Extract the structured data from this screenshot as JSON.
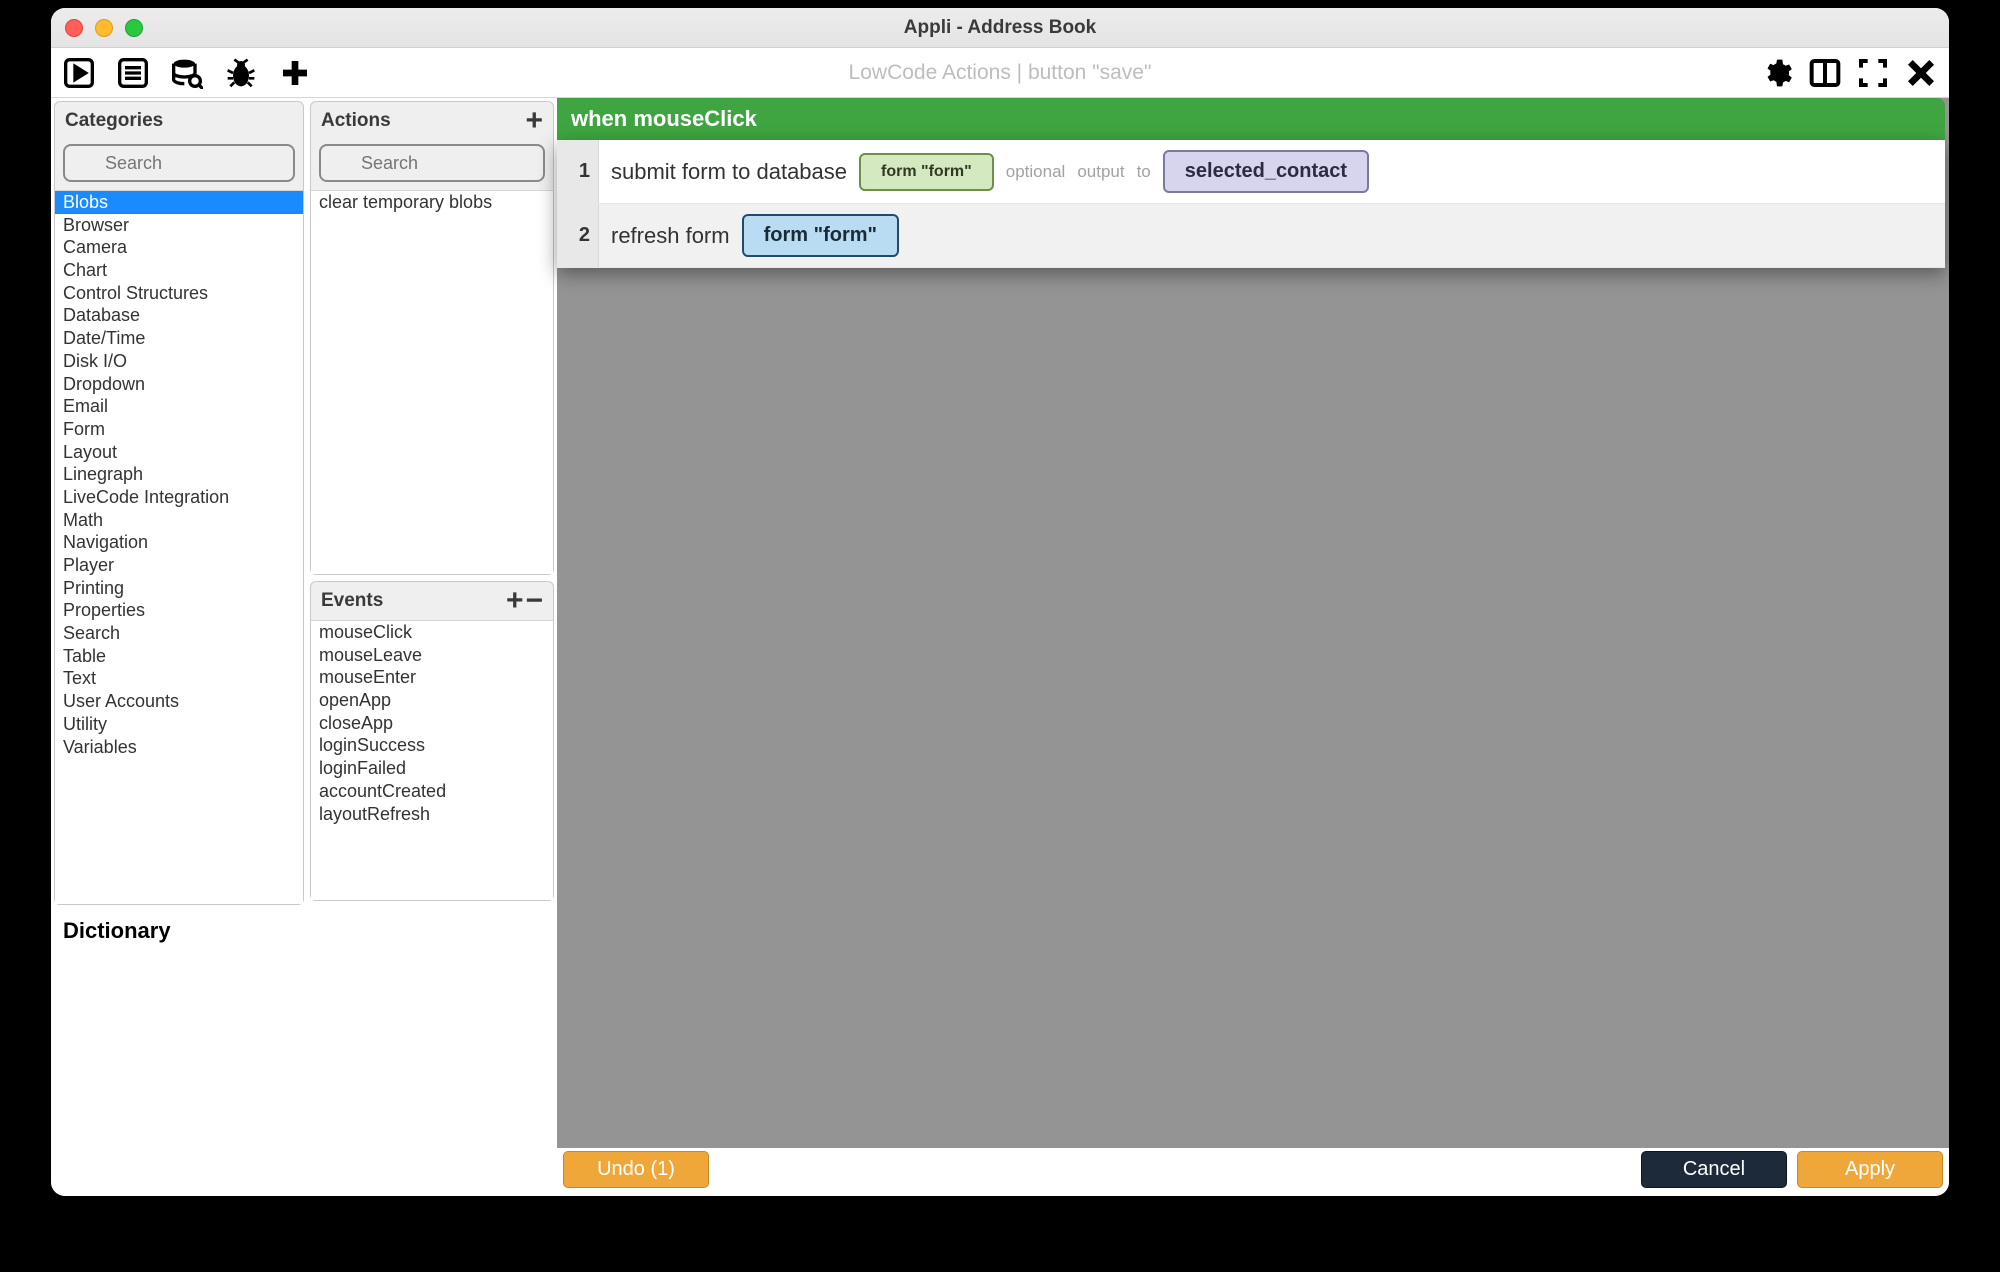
{
  "window": {
    "title": "Appli - Address Book"
  },
  "toolbar": {
    "subtitle": "LowCode Actions | button \"save\""
  },
  "categories": {
    "title": "Categories",
    "search_placeholder": "Search",
    "items": [
      "Blobs",
      "Browser",
      "Camera",
      "Chart",
      "Control Structures",
      "Database",
      "Date/Time",
      "Disk I/O",
      "Dropdown",
      "Email",
      "Form",
      "Layout",
      "Linegraph",
      "LiveCode Integration",
      "Math",
      "Navigation",
      "Player",
      "Printing",
      "Properties",
      "Search",
      "Table",
      "Text",
      "User Accounts",
      "Utility",
      "Variables"
    ],
    "selected": 0
  },
  "actions": {
    "title": "Actions",
    "search_placeholder": "Search",
    "items": [
      "clear temporary blobs"
    ]
  },
  "events": {
    "title": "Events",
    "items": [
      "mouseClick",
      "mouseLeave",
      "mouseEnter",
      "openApp",
      "closeApp",
      "loginSuccess",
      "loginFailed",
      "accountCreated",
      "layoutRefresh"
    ]
  },
  "dictionary": {
    "title": "Dictionary"
  },
  "editor": {
    "event_header": "when mouseClick",
    "steps": [
      {
        "num": "1",
        "text": "submit form to database",
        "chip1": "form \"form\"",
        "faint1": "optional",
        "faint2": "output",
        "faint3": "to",
        "chip2": "selected_contact"
      },
      {
        "num": "2",
        "text": "refresh form",
        "chip1": "form \"form\""
      }
    ]
  },
  "footer": {
    "undo": "Undo (1)",
    "cancel": "Cancel",
    "apply": "Apply"
  }
}
